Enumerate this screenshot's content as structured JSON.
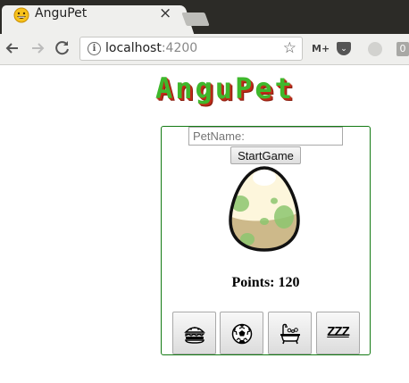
{
  "browser": {
    "tab_title": "AnguPet",
    "close_glyph": "×",
    "url_host": "localhost",
    "url_port": ":4200",
    "extensions": {
      "mplus_label": "M+",
      "badge_count": "0"
    }
  },
  "app": {
    "logo_text": "AnguPet",
    "pet_name_placeholder": "PetName:",
    "pet_name_value": "",
    "start_button_label": "StartGame",
    "points_text": "Points: 120",
    "sleep_button_label": "ZZZ",
    "actions": [
      "burger-icon",
      "soccer-ball-icon",
      "bathtub-icon",
      "zzz-text"
    ]
  },
  "colors": {
    "panel_border": "#137a13",
    "logo_green": "#3fb82c",
    "logo_shadow": "#c02a18",
    "egg_spots": "#8cc66f",
    "egg_base": "#c8b27a"
  }
}
